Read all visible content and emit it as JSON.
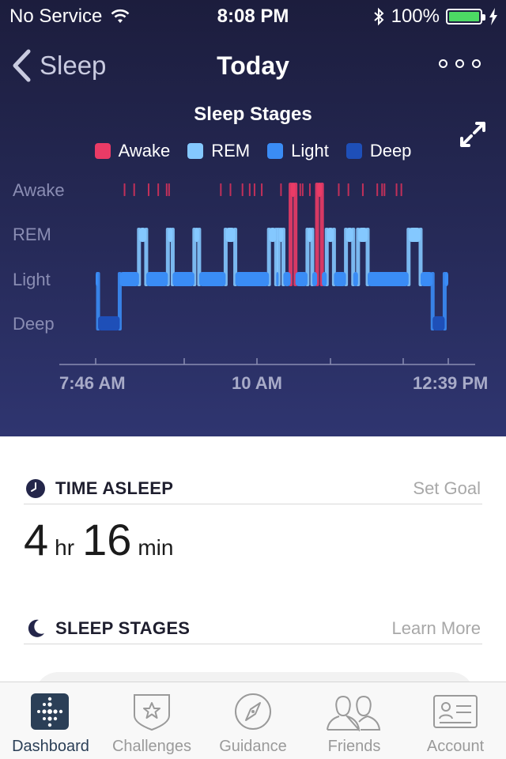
{
  "status_bar": {
    "carrier": "No Service",
    "time": "8:08 PM",
    "battery": "100%",
    "battery_level": 1.0
  },
  "nav": {
    "back_label": "Sleep",
    "title": "Today"
  },
  "chart": {
    "title": "Sleep Stages",
    "legend": [
      {
        "label": "Awake",
        "color": "#ea3b66"
      },
      {
        "label": "REM",
        "color": "#84c8ff"
      },
      {
        "label": "Light",
        "color": "#3a8cf5"
      },
      {
        "label": "Deep",
        "color": "#1e4fb8"
      }
    ],
    "y_labels": [
      "Awake",
      "REM",
      "Light",
      "Deep"
    ],
    "x_labels": [
      "7:46 AM",
      "10 AM",
      "12:39 PM"
    ]
  },
  "chart_data": {
    "type": "area",
    "title": "Sleep Stages",
    "stages": [
      "Deep",
      "Light",
      "REM",
      "Awake"
    ],
    "segments": [
      {
        "start": "7:46",
        "end": "7:48",
        "stage": "Light"
      },
      {
        "start": "7:48",
        "end": "8:06",
        "stage": "Deep"
      },
      {
        "start": "8:06",
        "end": "8:22",
        "stage": "Light"
      },
      {
        "start": "8:22",
        "end": "8:28",
        "stage": "REM"
      },
      {
        "start": "8:28",
        "end": "8:46",
        "stage": "Light"
      },
      {
        "start": "8:46",
        "end": "8:50",
        "stage": "REM"
      },
      {
        "start": "8:50",
        "end": "9:08",
        "stage": "Light"
      },
      {
        "start": "9:08",
        "end": "9:12",
        "stage": "REM"
      },
      {
        "start": "9:12",
        "end": "9:34",
        "stage": "Light"
      },
      {
        "start": "9:34",
        "end": "9:42",
        "stage": "REM"
      },
      {
        "start": "9:42",
        "end": "10:10",
        "stage": "Light"
      },
      {
        "start": "10:10",
        "end": "10:16",
        "stage": "REM"
      },
      {
        "start": "10:16",
        "end": "10:18",
        "stage": "Light"
      },
      {
        "start": "10:18",
        "end": "10:22",
        "stage": "REM"
      },
      {
        "start": "10:22",
        "end": "10:28",
        "stage": "Light"
      },
      {
        "start": "10:28",
        "end": "10:32",
        "stage": "Awake"
      },
      {
        "start": "10:32",
        "end": "10:42",
        "stage": "Light"
      },
      {
        "start": "10:42",
        "end": "10:46",
        "stage": "REM"
      },
      {
        "start": "10:46",
        "end": "10:50",
        "stage": "Light"
      },
      {
        "start": "10:50",
        "end": "10:54",
        "stage": "Awake"
      },
      {
        "start": "10:54",
        "end": "10:58",
        "stage": "Light"
      },
      {
        "start": "10:58",
        "end": "11:04",
        "stage": "REM"
      },
      {
        "start": "11:04",
        "end": "11:14",
        "stage": "Light"
      },
      {
        "start": "11:14",
        "end": "11:20",
        "stage": "REM"
      },
      {
        "start": "11:20",
        "end": "11:24",
        "stage": "Light"
      },
      {
        "start": "11:24",
        "end": "11:32",
        "stage": "REM"
      },
      {
        "start": "11:32",
        "end": "12:06",
        "stage": "Light"
      },
      {
        "start": "12:06",
        "end": "12:16",
        "stage": "REM"
      },
      {
        "start": "12:16",
        "end": "12:26",
        "stage": "Light"
      },
      {
        "start": "12:26",
        "end": "12:36",
        "stage": "Deep"
      },
      {
        "start": "12:36",
        "end": "12:39",
        "stage": "Light"
      }
    ],
    "awake_ticks": [
      "8:10",
      "8:18",
      "8:30",
      "8:38",
      "8:45",
      "8:47",
      "9:30",
      "9:38",
      "9:48",
      "9:54",
      "9:58",
      "10:04",
      "10:20",
      "10:30",
      "10:36",
      "10:38",
      "10:44",
      "10:52",
      "11:08",
      "11:16",
      "11:28",
      "11:40",
      "11:44",
      "11:46",
      "11:56",
      "12:00"
    ],
    "xlim": [
      "7:46 AM",
      "12:39 PM"
    ],
    "x_tick_labels": [
      "7:46 AM",
      "10 AM",
      "12:39 PM"
    ],
    "y_tick_labels": [
      "Awake",
      "REM",
      "Light",
      "Deep"
    ],
    "legend": [
      "Awake",
      "REM",
      "Light",
      "Deep"
    ],
    "legend_position": "top-center"
  },
  "time_asleep": {
    "title": "TIME ASLEEP",
    "link": "Set Goal",
    "hours": "4",
    "hours_unit": "hr",
    "minutes": "16",
    "minutes_unit": "min"
  },
  "sleep_stages": {
    "title": "SLEEP STAGES",
    "link": "Learn More"
  },
  "tab_bar": {
    "tabs": [
      {
        "label": "Dashboard",
        "icon": "dashboard-icon",
        "active": true
      },
      {
        "label": "Challenges",
        "icon": "challenges-icon",
        "active": false
      },
      {
        "label": "Guidance",
        "icon": "guidance-icon",
        "active": false
      },
      {
        "label": "Friends",
        "icon": "friends-icon",
        "active": false
      },
      {
        "label": "Account",
        "icon": "account-icon",
        "active": false
      }
    ]
  }
}
